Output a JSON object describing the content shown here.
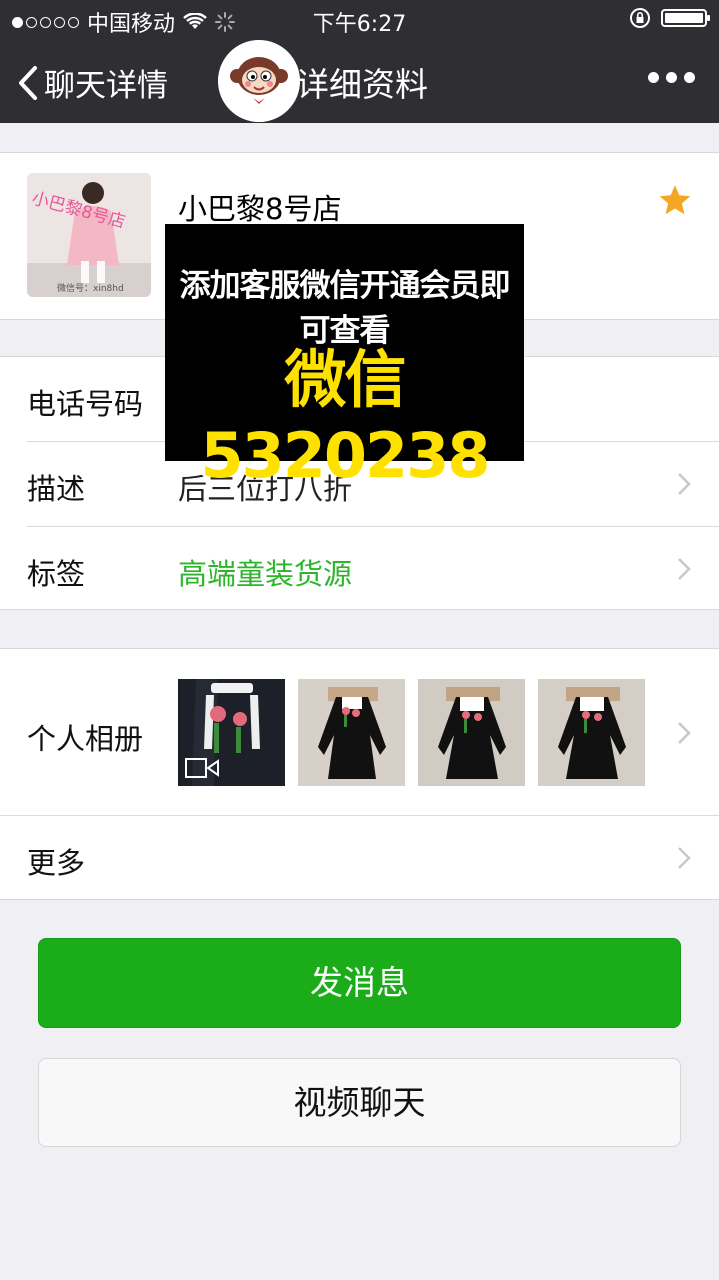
{
  "status_bar": {
    "carrier": "中国移动",
    "time": "下午6:27",
    "signal_level": "1/5",
    "icons": [
      "signal-dots-icon",
      "wifi-icon",
      "loading-spinner-icon",
      "orientation-lock-icon",
      "battery-icon"
    ]
  },
  "nav": {
    "back_label": "聊天详情",
    "title": "详细资料",
    "more_icon": "more-dots-icon"
  },
  "profile": {
    "name": "小巴黎8号店",
    "avatar_text": "小巴黎8号店",
    "avatar_watermark": "微信号：xin8hd",
    "starred": true
  },
  "promo": {
    "line1": "添加客服微信开通会员即可查看",
    "line2": "微信5320238"
  },
  "info": {
    "phone_label": "电话号码",
    "desc_label": "描述",
    "desc_value": "后三位打八折",
    "tag_label": "标签",
    "tag_value": "高端童装货源"
  },
  "album": {
    "label": "个人相册",
    "thumbnail_count": 4,
    "first_is_video": true
  },
  "more": {
    "label": "更多"
  },
  "buttons": {
    "send": "发消息",
    "video": "视频聊天"
  },
  "colors": {
    "nav_bg": "#2e2e33",
    "green": "#1aad19",
    "tag_green": "#2db52a",
    "star": "#f5a623",
    "promo_yellow": "#ffe100"
  }
}
